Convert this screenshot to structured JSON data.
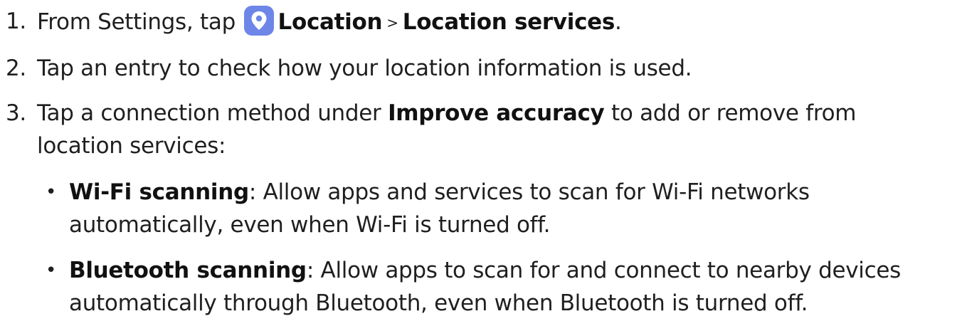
{
  "steps": [
    {
      "number": "1.",
      "pre": "From Settings, tap ",
      "icon": "location-pin-icon",
      "b1": "Location",
      "sep": ">",
      "b2": "Location services",
      "post": "."
    },
    {
      "number": "2.",
      "text": "Tap an entry to check how your location information is used."
    },
    {
      "number": "3.",
      "pre": "Tap a connection method under ",
      "bold": "Improve accuracy",
      "post_line1": " to add or remove from",
      "line2": "location services:"
    }
  ],
  "bullets": [
    {
      "title": "Wi-Fi scanning",
      "colon": ":",
      "line1": " Allow apps and services to scan for Wi-Fi networks",
      "line2": "automatically, even when Wi-Fi is turned off."
    },
    {
      "title": "Bluetooth scanning",
      "colon": ":",
      "line1": " Allow apps to scan for and connect to nearby devices",
      "line2": "automatically through Bluetooth, even when Bluetooth is turned off."
    }
  ],
  "colors": {
    "icon_bg": "#6e86e8",
    "text": "#1f1f1f"
  }
}
